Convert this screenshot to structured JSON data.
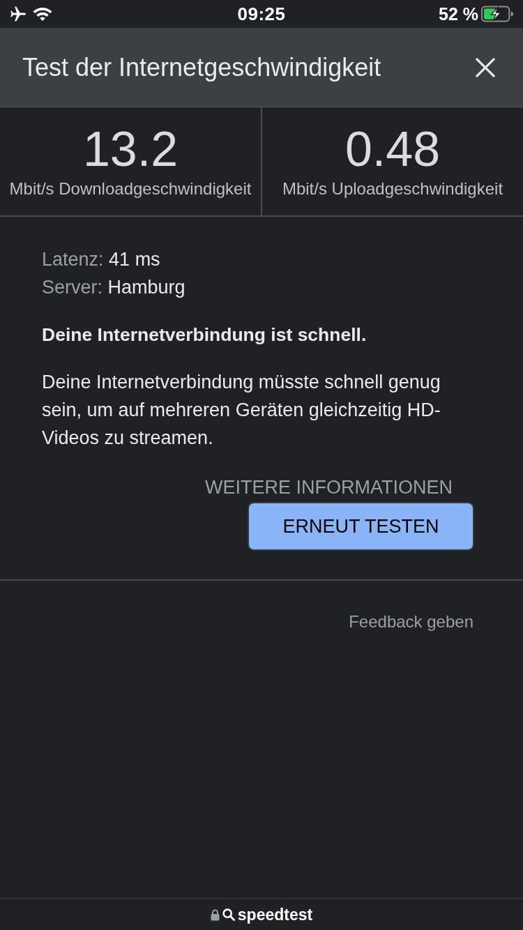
{
  "status_bar": {
    "time": "09:25",
    "battery": "52 %",
    "charging": true
  },
  "header": {
    "title": "Test der Internetgeschwindigkeit"
  },
  "results": [
    {
      "value": "13.2",
      "label": "Mbit/s Downloadgeschwindigkeit"
    },
    {
      "value": "0.48",
      "label": "Mbit/s Uploadgeschwindigkeit"
    }
  ],
  "details": [
    {
      "label": "Latenz:",
      "value": "41 ms"
    },
    {
      "label": "Server:",
      "value": "Hamburg"
    }
  ],
  "verdict": "Deine Internetverbindung ist schnell.",
  "description": "Deine Internetverbindung müsste schnell genug sein, um auf mehreren Geräten gleichzeitig HD-Videos zu streamen.",
  "more_info_link": "WEITERE INFORMATIONEN",
  "retest_button": "ERNEUT TESTEN",
  "feedback_link": "Feedback geben",
  "address_bar": {
    "site": "speedtest",
    "secure": true
  }
}
